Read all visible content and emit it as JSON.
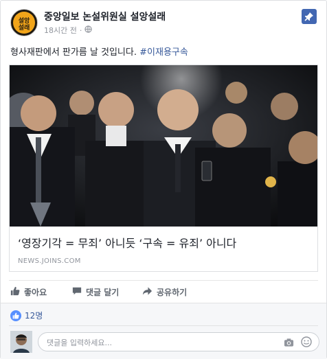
{
  "post": {
    "page_name": "중앙일보 논설위원실 설앙설래",
    "avatar_line1": "설앙",
    "avatar_line2": "설래",
    "time": "18시간 전",
    "time_separator": "·",
    "text": "형사재판에서 판가름 날 것입니다.",
    "hashtag": "#이재용구속"
  },
  "link": {
    "title": "‘영장기각 = 무죄’ 아니듯 ‘구속 = 유죄’ 아니다",
    "domain": "NEWS.JOINS.COM"
  },
  "actions": {
    "like": "좋아요",
    "comment": "댓글 달기",
    "share": "공유하기"
  },
  "reactions": {
    "count": "12명"
  },
  "comment": {
    "placeholder": "댓글을 입력하세요..."
  },
  "colors": {
    "brand_blue": "#4267b2",
    "link_blue": "#365899",
    "avatar_gold": "#f2a51a"
  }
}
